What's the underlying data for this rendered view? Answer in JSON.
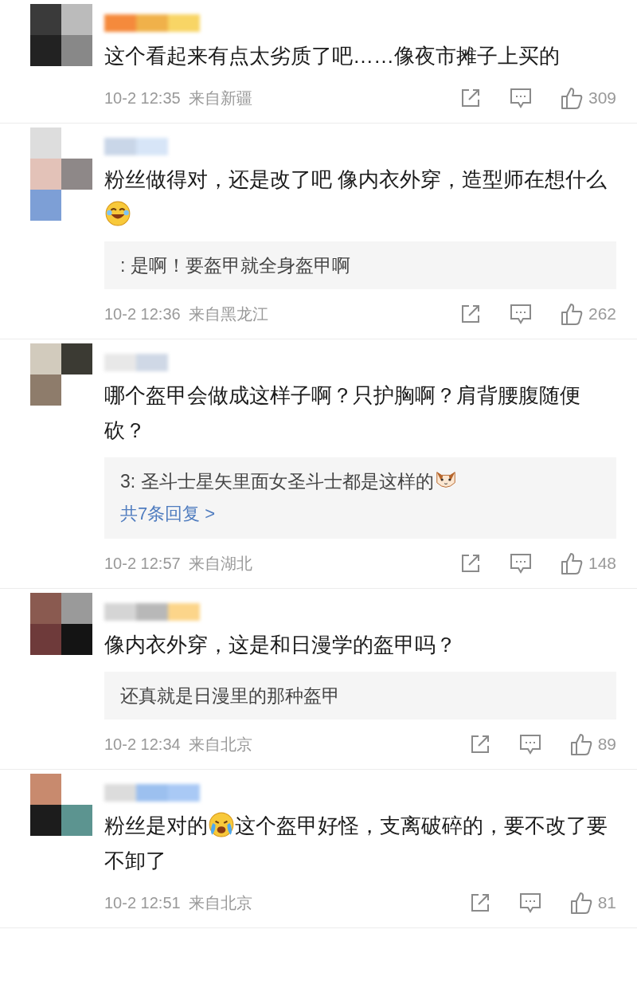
{
  "comments": [
    {
      "content": [
        {
          "kind": "text",
          "text": "这个看起来有点太劣质了吧……像夜市摊子上买的"
        }
      ],
      "time": "10-2 12:35",
      "location": "来自新疆",
      "likes": "309"
    },
    {
      "content": [
        {
          "kind": "text",
          "text": "粉丝做得对，还是改了吧 像内衣外穿，造型师在想什么"
        },
        {
          "kind": "laughing-emoji"
        }
      ],
      "reply": {
        "content": [
          {
            "kind": "text",
            "text": ": 是啊！要盔甲就全身盔甲啊"
          }
        ]
      },
      "time": "10-2 12:36",
      "location": "来自黑龙江",
      "likes": "262"
    },
    {
      "content": [
        {
          "kind": "text",
          "text": "哪个盔甲会做成这样子啊？只护胸啊？肩背腰腹随便砍？"
        }
      ],
      "reply": {
        "content": [
          {
            "kind": "text",
            "text": "3: 圣斗士星矢里面女圣斗士都是这样的"
          },
          {
            "kind": "cat-emoji"
          }
        ],
        "more": "共7条回复 >"
      },
      "time": "10-2 12:57",
      "location": "来自湖北",
      "likes": "148"
    },
    {
      "content": [
        {
          "kind": "text",
          "text": "像内衣外穿，这是和日漫学的盔甲吗？"
        }
      ],
      "reply": {
        "content": [
          {
            "kind": "text",
            "text": "还真就是日漫里的那种盔甲"
          }
        ]
      },
      "time": "10-2 12:34",
      "location": "来自北京",
      "likes": "89"
    },
    {
      "content": [
        {
          "kind": "text",
          "text": "粉丝是对的"
        },
        {
          "kind": "crying-emoji"
        },
        {
          "kind": "text",
          "text": "这个盔甲好怪，支离破碎的，要不改了要不卸了"
        }
      ],
      "time": "10-2 12:51",
      "location": "来自北京",
      "likes": "81"
    }
  ]
}
